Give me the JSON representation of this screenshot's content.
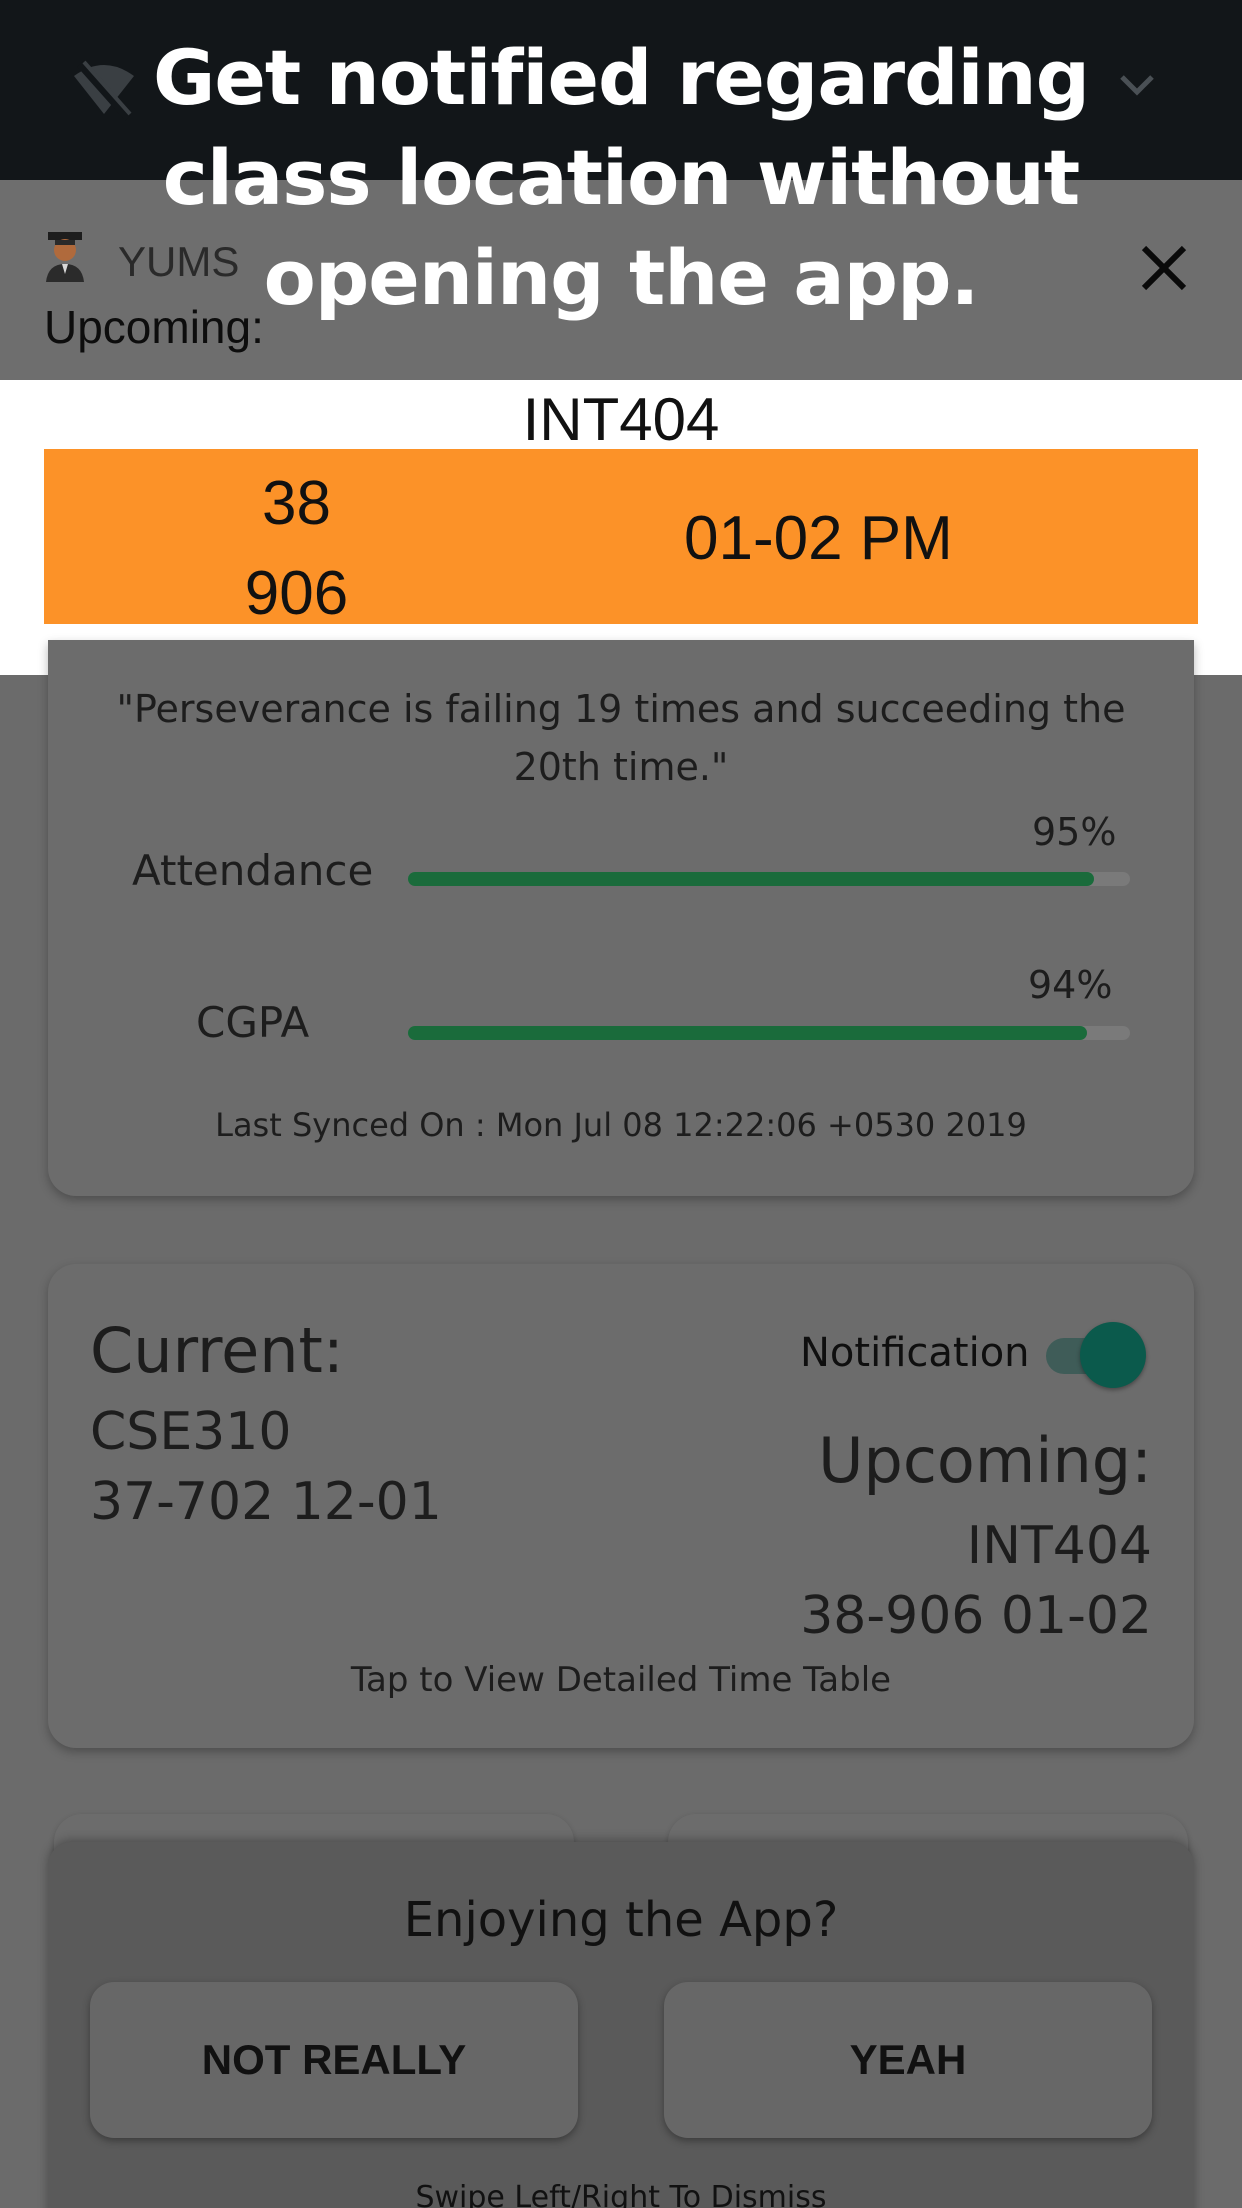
{
  "overlay": {
    "headline_line1": "Get notified regarding",
    "headline_line2": "class location without",
    "headline_line3": "opening the app."
  },
  "status_bar": {
    "icons": [
      "wifi-off-icon",
      "chevron-down-icon"
    ]
  },
  "notification": {
    "app_name": "YUMS",
    "label": "Upcoming:",
    "course_code": "INT404",
    "building": "38",
    "room": "906",
    "time": "01-02 PM",
    "accent_color": "#fc9228"
  },
  "stats_card": {
    "quote": "\"Perseverance is failing 19 times and succeeding the 20th time.\"",
    "attendance_label": "Attendance",
    "attendance_value": "95%",
    "attendance_fraction": 0.95,
    "cgpa_label": "CGPA",
    "cgpa_value": "94%",
    "cgpa_fraction": 0.94,
    "bar_color": "#1a6b3b",
    "last_synced": "Last Synced On : Mon Jul 08 12:22:06 +0530 2019"
  },
  "schedule_card": {
    "current_title": "Current:",
    "current_course": "CSE310",
    "current_room_time": "37-702  12-01",
    "notification_label": "Notification",
    "notification_enabled": true,
    "upcoming_title": "Upcoming:",
    "upcoming_course": "INT404",
    "upcoming_room_time": "38-906  01-02",
    "tap_hint": "Tap to View Detailed Time Table"
  },
  "rating_prompt": {
    "title": "Enjoying the App?",
    "no_label": "NOT REALLY",
    "yes_label": "YEAH",
    "swipe_hint": "Swipe Left/Right To Dismiss"
  }
}
